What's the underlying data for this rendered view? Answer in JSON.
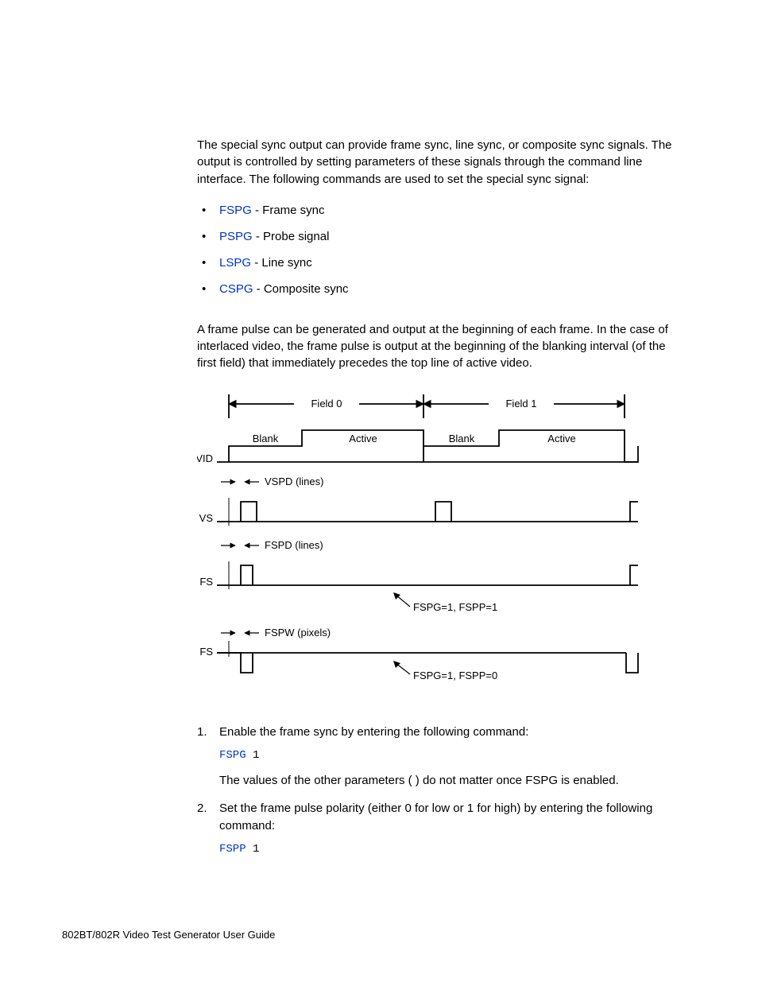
{
  "intro": "The special sync output can provide frame sync, line sync, or composite sync signals. The output is controlled by setting parameters of these signals through the command line interface. The following commands are used to set the special sync signal:",
  "bullets": [
    {
      "cmd": "FSPG",
      "desc": " - Frame sync"
    },
    {
      "cmd": "PSPG",
      "desc": " - Probe signal"
    },
    {
      "cmd": "LSPG",
      "desc": " - Line sync"
    },
    {
      "cmd": "CSPG",
      "desc": " - Composite sync"
    }
  ],
  "para2": "A frame pulse can be generated and output at the beginning of each frame. In the case of interlaced video, the frame pulse is output at the beginning of the blanking interval (of the first field) that immediately precedes the top line of active video.",
  "diagram": {
    "field0": "Field 0",
    "field1": "Field 1",
    "blank": "Blank",
    "active": "Active",
    "vid": "VID",
    "vs": "VS",
    "fs": "FS",
    "vspd": "VSPD (lines)",
    "fspd": "FSPD (lines)",
    "fspw": "FSPW (pixels)",
    "ann1": "FSPG=1, FSPP=1",
    "ann2": "FSPG=1, FSPP=0"
  },
  "step1": {
    "text": "Enable the frame sync by entering the following command:",
    "cmd": "FSPG",
    "arg": " 1",
    "after": "The values of the other parameters (                             ) do not matter once FSPG is enabled."
  },
  "step2": {
    "text": "Set the frame pulse polarity (either 0 for low or 1 for high) by entering the following command:",
    "cmd": "FSPP",
    "arg": " 1"
  },
  "footer": "802BT/802R Video Test Generator User Guide"
}
